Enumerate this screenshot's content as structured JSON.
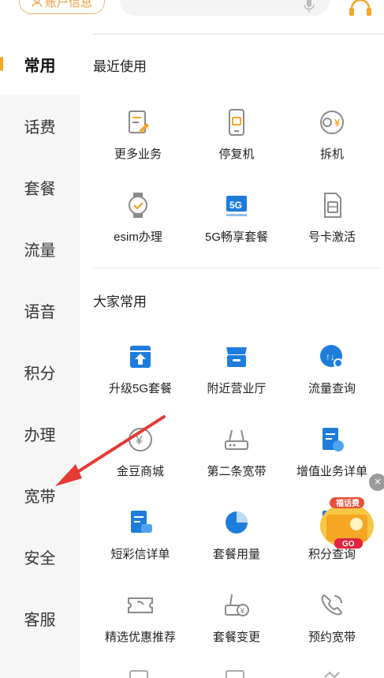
{
  "header": {
    "account_label": "账户信息"
  },
  "sidebar": {
    "items": [
      {
        "label": "常用",
        "active": true
      },
      {
        "label": "话费"
      },
      {
        "label": "套餐"
      },
      {
        "label": "流量"
      },
      {
        "label": "语音"
      },
      {
        "label": "积分"
      },
      {
        "label": "办理"
      },
      {
        "label": "宽带"
      },
      {
        "label": "安全"
      },
      {
        "label": "客服"
      }
    ]
  },
  "recent": {
    "title": "最近使用",
    "items": [
      {
        "label": "更多业务",
        "icon": "document-edit-icon"
      },
      {
        "label": "停复机",
        "icon": "phone-icon"
      },
      {
        "label": "拆机",
        "icon": "yuan-cycle-icon"
      },
      {
        "label": "esim办理",
        "icon": "watch-icon"
      },
      {
        "label": "5G畅享套餐",
        "icon": "5g-icon"
      },
      {
        "label": "号卡激活",
        "icon": "sim-card-icon"
      }
    ]
  },
  "popular": {
    "title": "大家常用",
    "items": [
      {
        "label": "升级5G套餐",
        "icon": "upgrade-icon"
      },
      {
        "label": "附近营业厅",
        "icon": "store-icon"
      },
      {
        "label": "流量查询",
        "icon": "data-query-icon"
      },
      {
        "label": "金豆商城",
        "icon": "coin-icon"
      },
      {
        "label": "第二条宽带",
        "icon": "router-icon"
      },
      {
        "label": "增值业务详单",
        "icon": "bill-icon"
      },
      {
        "label": "短彩信详单",
        "icon": "sms-bill-icon"
      },
      {
        "label": "套餐用量",
        "icon": "pie-chart-icon"
      },
      {
        "label": "积分查询",
        "icon": "points-icon"
      },
      {
        "label": "精选优惠推荐",
        "icon": "ticket-icon"
      },
      {
        "label": "套餐变更",
        "icon": "router-yuan-icon"
      },
      {
        "label": "预约宽带",
        "icon": "phone-call-icon"
      }
    ]
  },
  "promo": {
    "badge_text": "福话费",
    "go_text": "GO"
  },
  "colors": {
    "accent": "#f5a623",
    "icon_blue": "#1e7ddc",
    "icon_gray": "#8a8a8a"
  }
}
